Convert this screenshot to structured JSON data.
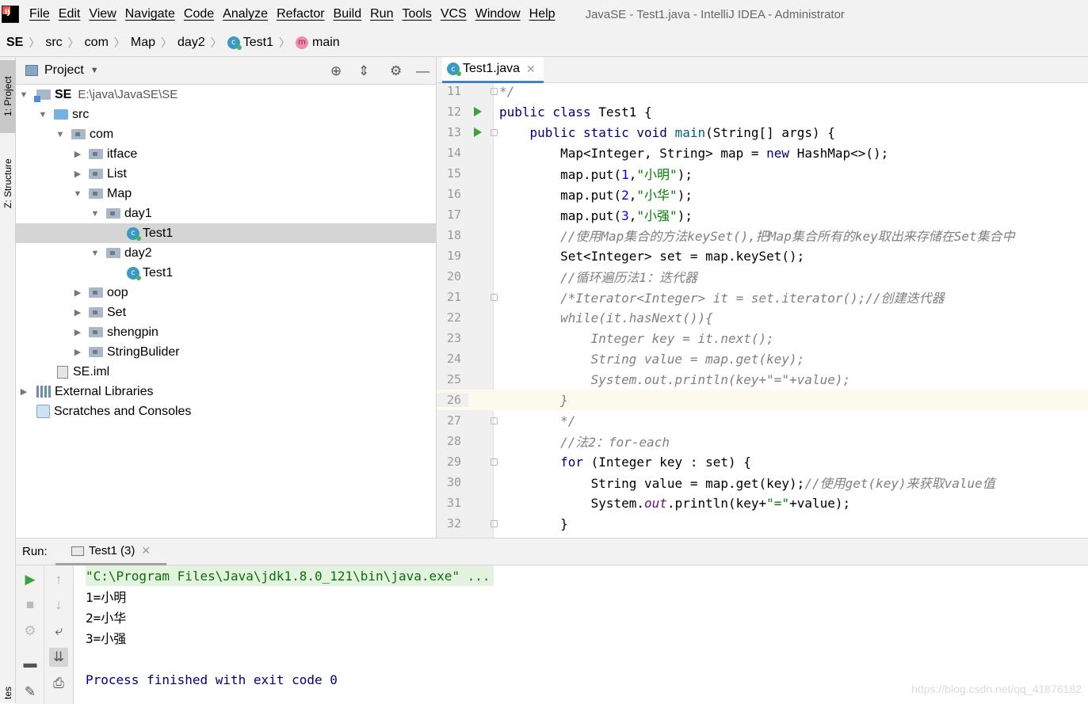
{
  "menubar": {
    "items": [
      "File",
      "Edit",
      "View",
      "Navigate",
      "Code",
      "Analyze",
      "Refactor",
      "Build",
      "Run",
      "Tools",
      "VCS",
      "Window",
      "Help"
    ],
    "window_title": "JavaSE - Test1.java - IntelliJ IDEA - Administrator"
  },
  "breadcrumb": [
    "SE",
    "src",
    "com",
    "Map",
    "day2",
    "Test1",
    "main"
  ],
  "left_stripe": {
    "project_tab": "1: Project",
    "structure_tab": "Z: Structure",
    "bottom_tab": "tes"
  },
  "project": {
    "title": "Project",
    "root_name": "SE",
    "root_path": "E:\\java\\JavaSE\\SE",
    "tree": [
      "src",
      "com",
      "itface",
      "List",
      "Map",
      "day1",
      "Test1",
      "day2",
      "Test1",
      "oop",
      "Set",
      "shengpin",
      "StringBulider",
      "SE.iml",
      "External Libraries",
      "Scratches and Consoles"
    ]
  },
  "editor": {
    "tab": "Test1.java",
    "line_numbers": [
      "11",
      "12",
      "13",
      "14",
      "15",
      "16",
      "17",
      "18",
      "19",
      "20",
      "21",
      "22",
      "23",
      "24",
      "25",
      "26",
      "27",
      "28",
      "29",
      "30",
      "31",
      "32"
    ]
  },
  "run": {
    "label": "Run:",
    "tab": "Test1 (3)",
    "console": {
      "command": "\"C:\\Program Files\\Java\\jdk1.8.0_121\\bin\\java.exe\" ...",
      "lines": [
        "1=小明",
        "2=小华",
        "3=小强"
      ],
      "finished": "Process finished with exit code 0"
    }
  },
  "watermark": "https://blog.csdn.net/qq_41876182",
  "colors": {
    "keyword": "#000080",
    "comment": "#808080",
    "string": "#008000",
    "number": "#0000ff",
    "accent": "#4083c9"
  }
}
